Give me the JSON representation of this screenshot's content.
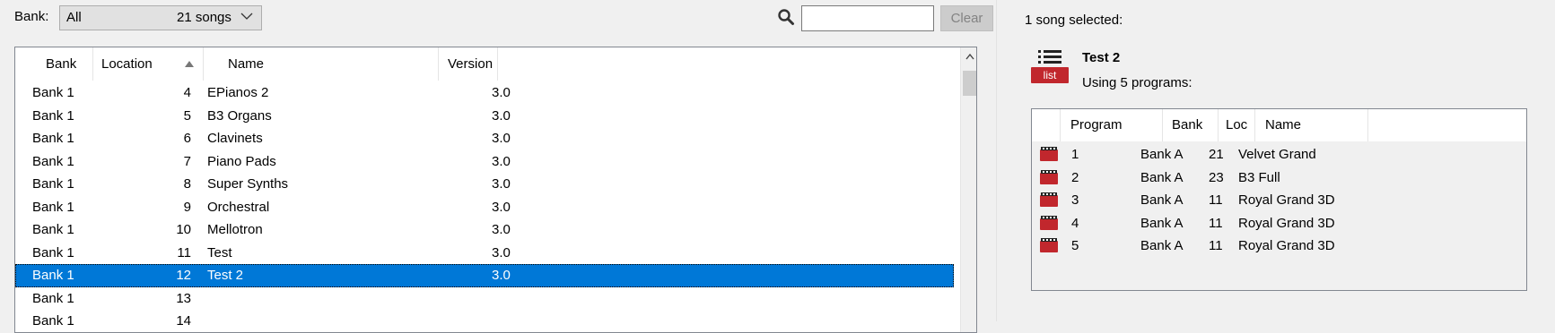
{
  "toolbar": {
    "bank_label": "Bank:",
    "bank_value": "All",
    "song_count": "21 songs",
    "search_placeholder": "",
    "clear_label": "Clear"
  },
  "songs": {
    "columns": {
      "bank": "Bank",
      "location": "Location",
      "name": "Name",
      "version": "Version"
    },
    "sort_column": "Location",
    "sort_direction": "ascending",
    "rows": [
      {
        "bank": "Bank 1",
        "location": "4",
        "name": "EPianos 2",
        "version": "3.0"
      },
      {
        "bank": "Bank 1",
        "location": "5",
        "name": "B3 Organs",
        "version": "3.0"
      },
      {
        "bank": "Bank 1",
        "location": "6",
        "name": "Clavinets",
        "version": "3.0"
      },
      {
        "bank": "Bank 1",
        "location": "7",
        "name": "Piano Pads",
        "version": "3.0"
      },
      {
        "bank": "Bank 1",
        "location": "8",
        "name": "Super Synths",
        "version": "3.0"
      },
      {
        "bank": "Bank 1",
        "location": "9",
        "name": "Orchestral",
        "version": "3.0"
      },
      {
        "bank": "Bank 1",
        "location": "10",
        "name": "Mellotron",
        "version": "3.0"
      },
      {
        "bank": "Bank 1",
        "location": "11",
        "name": "Test",
        "version": "3.0"
      },
      {
        "bank": "Bank 1",
        "location": "12",
        "name": "Test 2",
        "version": "3.0"
      },
      {
        "bank": "Bank 1",
        "location": "13",
        "name": "",
        "version": ""
      },
      {
        "bank": "Bank 1",
        "location": "14",
        "name": "",
        "version": ""
      }
    ]
  },
  "detail": {
    "selected_count": "1 song selected:",
    "icon_name": "list-icon",
    "icon_label": "list",
    "song_title": "Test 2",
    "programs_text": "Using 5 programs:",
    "columns": {
      "program": "Program",
      "bank": "Bank",
      "loc": "Loc",
      "name": "Name"
    },
    "programs": [
      {
        "program": "1",
        "bank": "Bank A",
        "loc": "21",
        "name": "Velvet Grand"
      },
      {
        "program": "2",
        "bank": "Bank A",
        "loc": "23",
        "name": "B3 Full"
      },
      {
        "program": "3",
        "bank": "Bank A",
        "loc": "11",
        "name": "Royal Grand 3D"
      },
      {
        "program": "4",
        "bank": "Bank A",
        "loc": "11",
        "name": "Royal Grand 3D"
      },
      {
        "program": "5",
        "bank": "Bank A",
        "loc": "11",
        "name": "Royal Grand 3D"
      }
    ]
  },
  "colors": {
    "selection": "#0078d7",
    "icon_red": "#c1272d"
  }
}
